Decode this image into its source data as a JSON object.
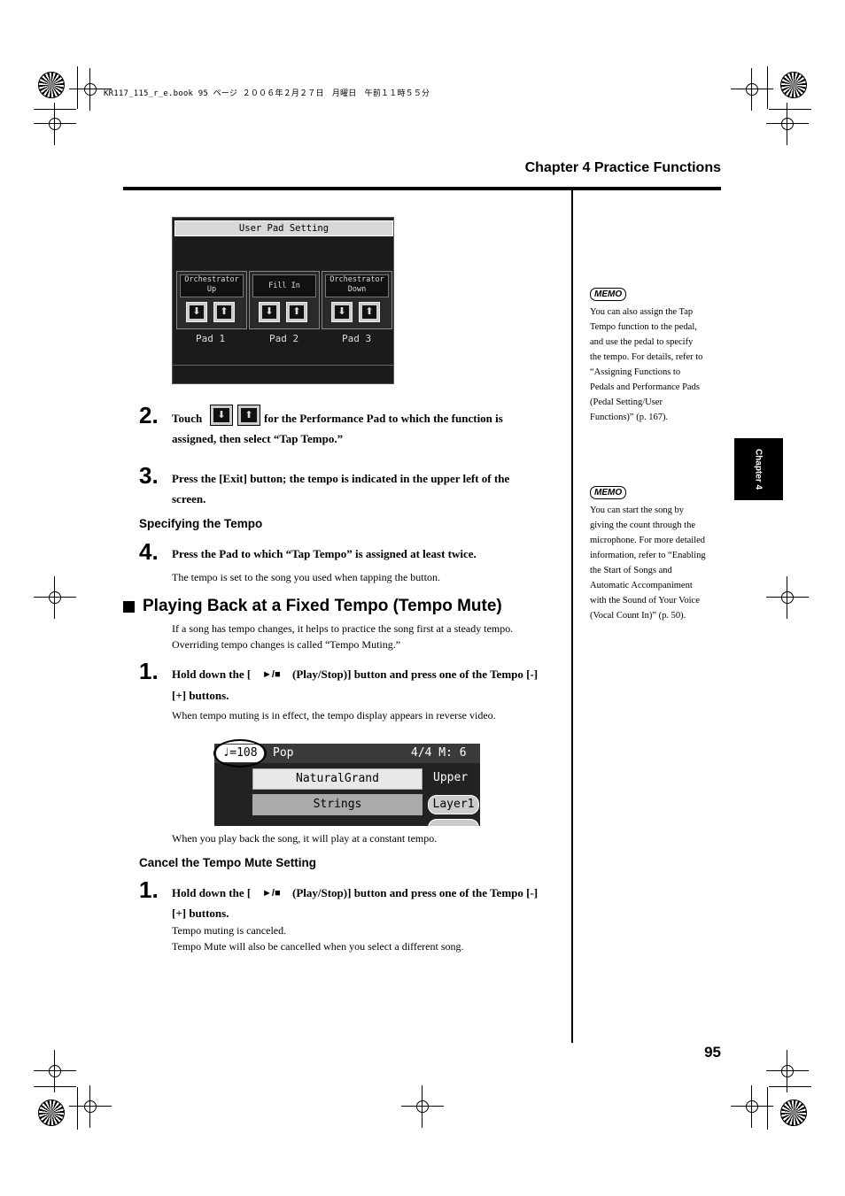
{
  "header": {
    "file_line": "KR117_115_r_e.book  95 ページ  ２００６年２月２７日　月曜日　午前１１時５５分",
    "chapter_title": "Chapter 4 Practice Functions"
  },
  "screen1": {
    "title": "User Pad Setting",
    "pads": [
      {
        "name_line1": "Orchestrator",
        "name_line2": "Up",
        "label": "Pad  1"
      },
      {
        "name_line1": "Fill In",
        "name_line2": "",
        "label": "Pad  2"
      },
      {
        "name_line1": "Orchestrator",
        "name_line2": "Down",
        "label": "Pad  3"
      }
    ],
    "down_arrow": "⬇",
    "up_arrow": "⬆"
  },
  "steps": {
    "s2_num": "2.",
    "s2_pre": "Touch",
    "s2_post": "for the Performance Pad to which the function is",
    "s2_line2": "assigned, then select “Tap Tempo.”",
    "s3_num": "3.",
    "s3_line1": "Press the [Exit] button; the tempo is indicated in the upper left of the",
    "s3_line2": "screen.",
    "spec_head": "Specifying the Tempo",
    "s4_num": "4.",
    "s4_text": "Press the Pad to which “Tap Tempo” is assigned at least twice.",
    "s4_body": "The tempo is set to the song you used when tapping the button."
  },
  "section": {
    "heading": "Playing Back at a Fixed Tempo (Tempo Mute)",
    "intro1": "If a song has tempo changes, it helps to practice the song first at a steady tempo.",
    "intro2": "Overriding tempo changes is called “Tempo Muting.”",
    "m1_num": "1.",
    "m1_pre": "Hold down the [",
    "m1_post": "(Play/Stop)] button and press one of the Tempo [-]",
    "m1_line2": "[+] buttons.",
    "m1_body": "When tempo muting is in effect, the tempo display appears in reverse video.",
    "after_screen": "When you play back the song, it will play at a constant tempo.",
    "cancel_head": "Cancel the Tempo Mute Setting",
    "c1_num": "1.",
    "c1_pre": "Hold down the [",
    "c1_post": "(Play/Stop)] button and press one of the Tempo [-]",
    "c1_line2": "[+] buttons.",
    "c1_body1": "Tempo muting is canceled.",
    "c1_body2": "Tempo Mute will also be cancelled when you select a different song.",
    "play_stop_symbol": "►/■"
  },
  "screen2": {
    "tempo": "♩=108",
    "style": "Pop",
    "meter": "4/4  M:  6",
    "row1_box": "NaturalGrand",
    "row1_pill": "Upper",
    "row2_box": "Strings",
    "row2_pill": "Layer1"
  },
  "memo1": {
    "badge": "MEMO",
    "lines": [
      "You can also assign the Tap",
      "Tempo function to the pedal,",
      "and use the pedal to specify",
      "the tempo. For details, refer to",
      "“Assigning Functions to",
      "Pedals and Performance Pads",
      "(Pedal Setting/User",
      "Functions)” (p. 167)."
    ]
  },
  "memo2": {
    "badge": "MEMO",
    "lines": [
      "You can start the song by",
      "giving the count through the",
      "microphone. For more detailed",
      "information, refer to “Enabling",
      "the Start of Songs and",
      "Automatic Accompaniment",
      "with the Sound of Your Voice",
      "(Vocal Count In)” (p. 50)."
    ]
  },
  "chapter_tab": "Chapter 4",
  "page_number": "95"
}
